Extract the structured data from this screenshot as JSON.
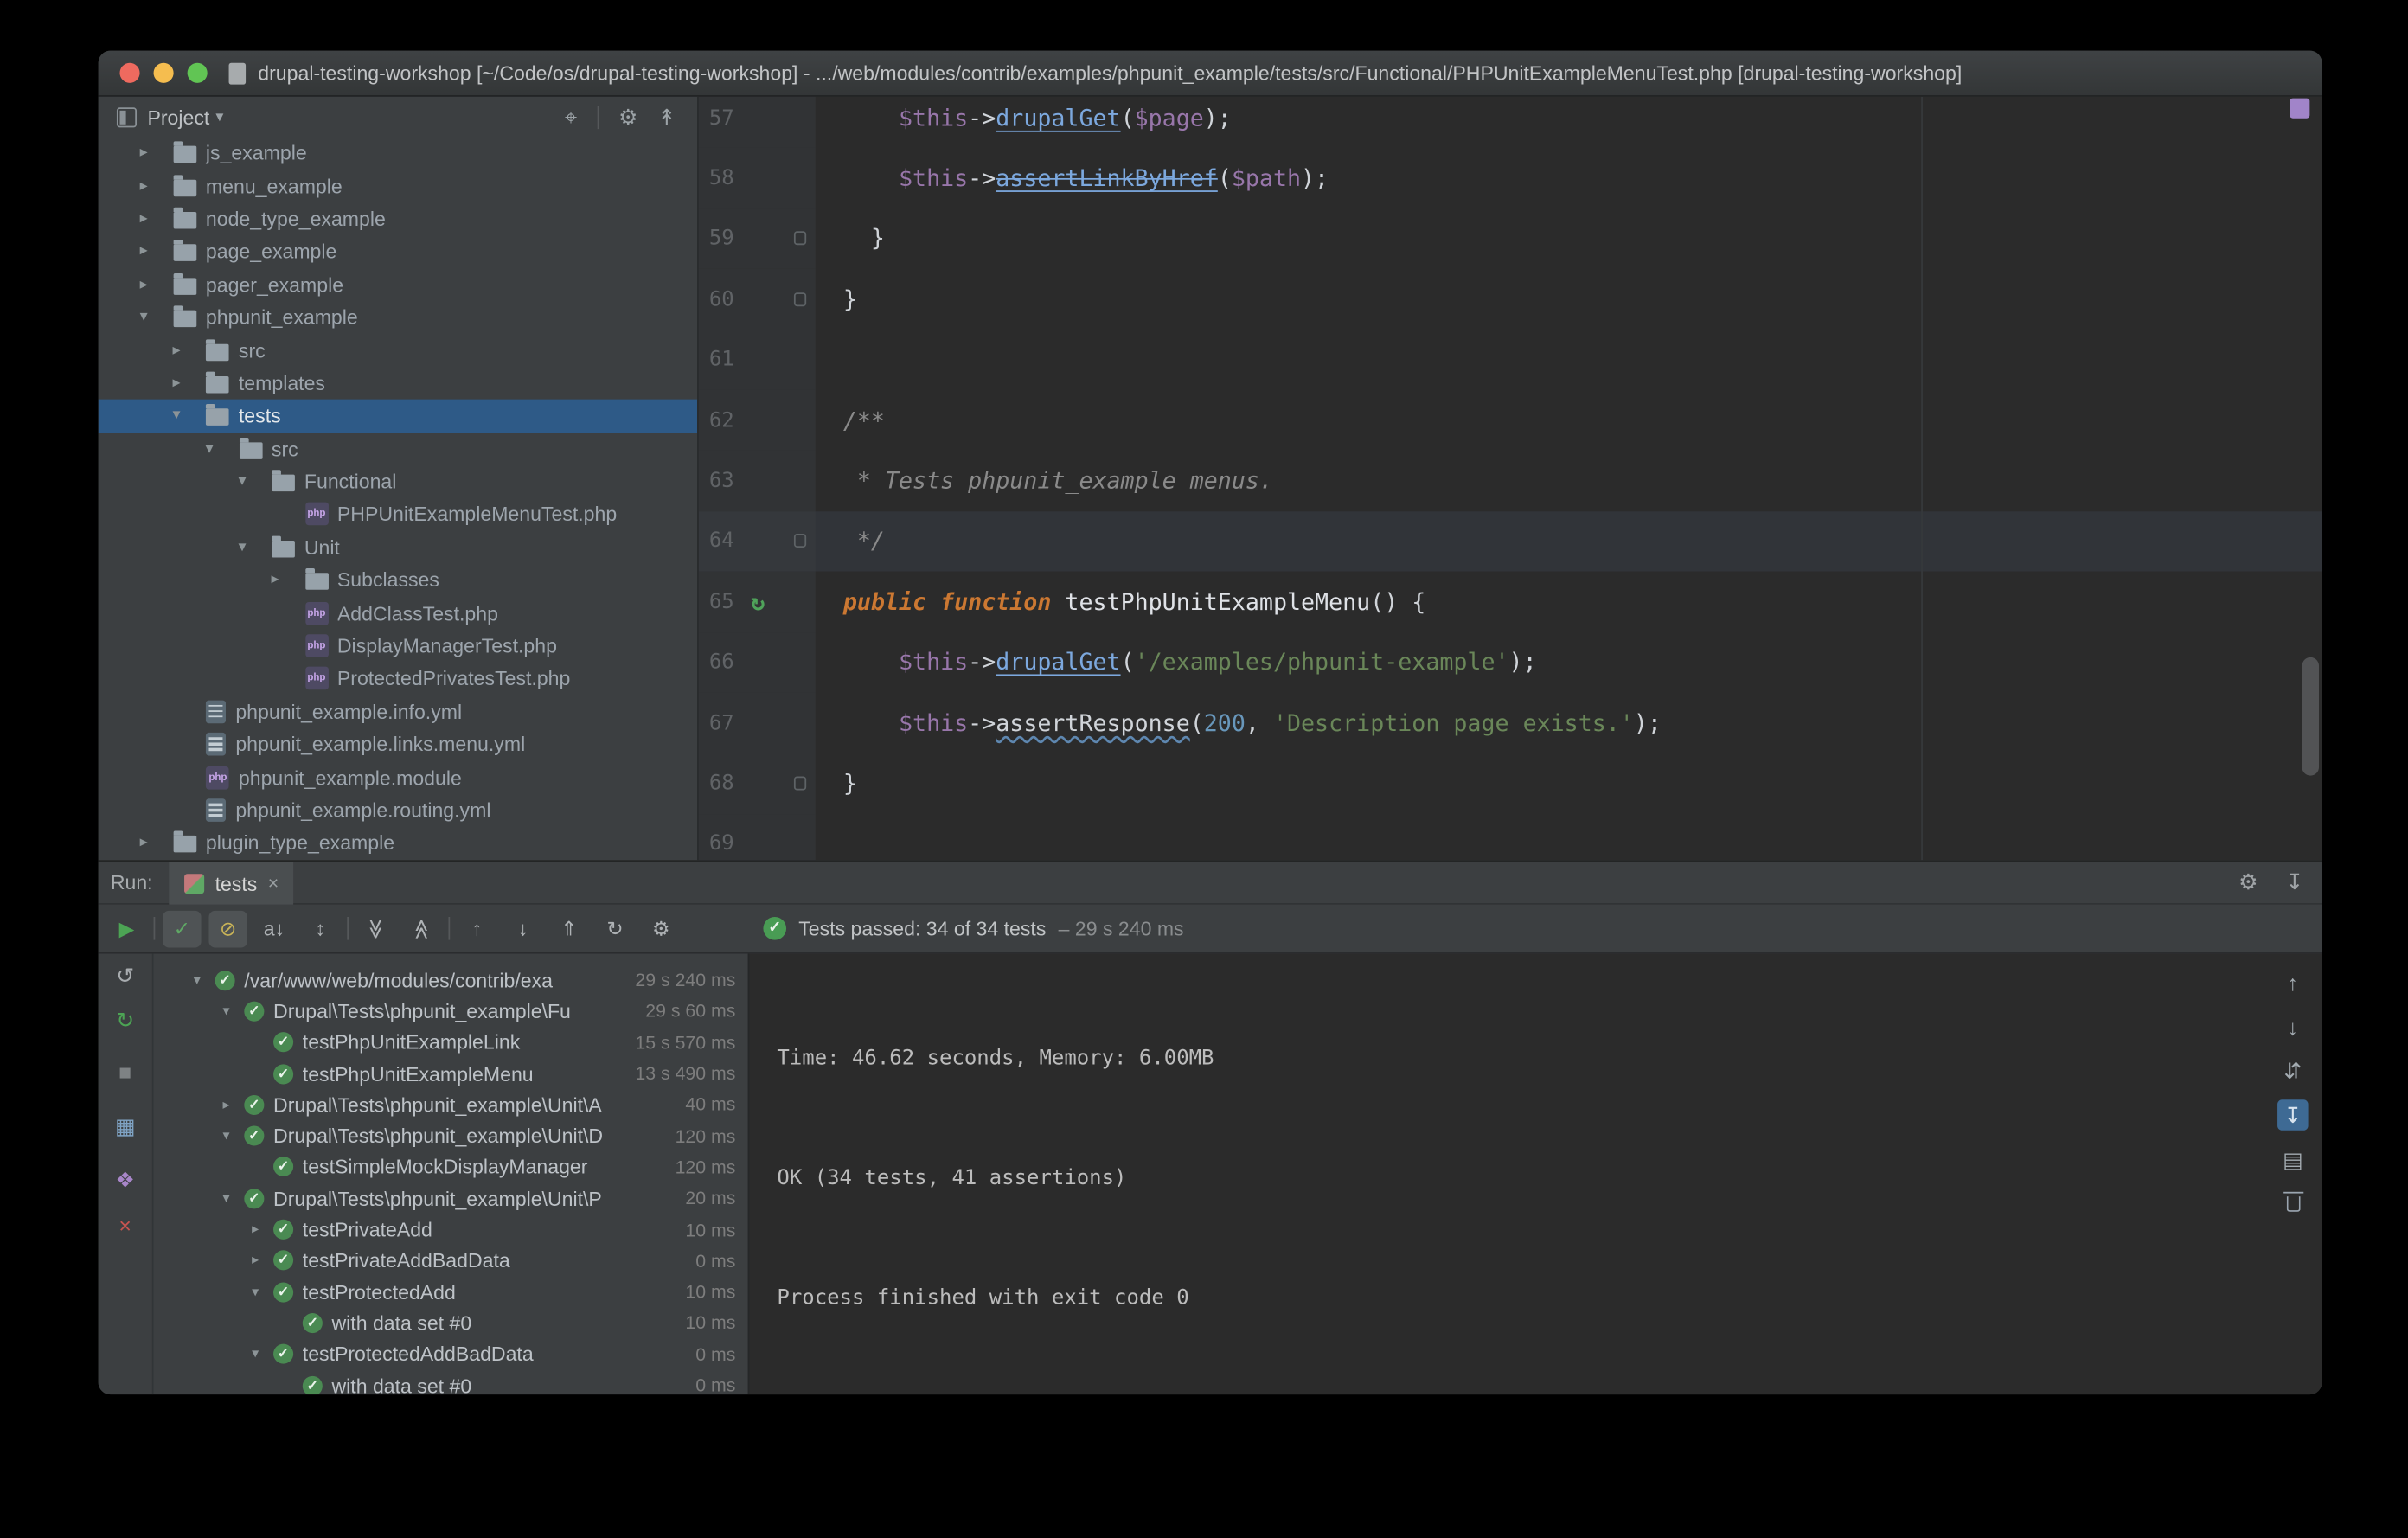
{
  "window": {
    "title": "drupal-testing-workshop [~/Code/os/drupal-testing-workshop] - .../web/modules/contrib/examples/phpunit_example/tests/src/Functional/PHPUnitExampleMenuTest.php [drupal-testing-workshop]"
  },
  "colors": {
    "accent_green": "#499C54",
    "selection_blue": "#2E5A87",
    "error_red": "#C75450",
    "editor_bg": "#2B2B2B",
    "panel_bg": "#3C3F41"
  },
  "project_panel": {
    "title": "Project",
    "actions": [
      {
        "name": "select-opened-file-button",
        "glyph": "⌖"
      },
      {
        "name": "divider"
      },
      {
        "name": "project-settings-button",
        "glyph": "⚙"
      },
      {
        "name": "collapse-all-button",
        "glyph": "↟"
      }
    ],
    "tree": [
      {
        "label": "js_example",
        "depth": 0,
        "arrow": "right",
        "icon": "folder"
      },
      {
        "label": "menu_example",
        "depth": 0,
        "arrow": "right",
        "icon": "folder"
      },
      {
        "label": "node_type_example",
        "depth": 0,
        "arrow": "right",
        "icon": "folder"
      },
      {
        "label": "page_example",
        "depth": 0,
        "arrow": "right",
        "icon": "folder"
      },
      {
        "label": "pager_example",
        "depth": 0,
        "arrow": "right",
        "icon": "folder"
      },
      {
        "label": "phpunit_example",
        "depth": 0,
        "arrow": "down",
        "icon": "folder"
      },
      {
        "label": "src",
        "depth": 1,
        "arrow": "right",
        "icon": "folder"
      },
      {
        "label": "templates",
        "depth": 1,
        "arrow": "right",
        "icon": "folder"
      },
      {
        "label": "tests",
        "depth": 1,
        "arrow": "down",
        "icon": "folder",
        "selected": true
      },
      {
        "label": "src",
        "depth": 2,
        "arrow": "down",
        "icon": "folder"
      },
      {
        "label": "Functional",
        "depth": 3,
        "arrow": "down",
        "icon": "folder"
      },
      {
        "label": "PHPUnitExampleMenuTest.php",
        "depth": 4,
        "icon": "php"
      },
      {
        "label": "Unit",
        "depth": 3,
        "arrow": "down",
        "icon": "folder"
      },
      {
        "label": "Subclasses",
        "depth": 4,
        "arrow": "right",
        "icon": "folder"
      },
      {
        "label": "AddClassTest.php",
        "depth": 4,
        "icon": "php"
      },
      {
        "label": "DisplayManagerTest.php",
        "depth": 4,
        "icon": "php"
      },
      {
        "label": "ProtectedPrivatesTest.php",
        "depth": 4,
        "icon": "php"
      },
      {
        "label": "phpunit_example.info.yml",
        "depth": 1,
        "icon": "yml"
      },
      {
        "label": "phpunit_example.links.menu.yml",
        "depth": 1,
        "icon": "yml"
      },
      {
        "label": "phpunit_example.module",
        "depth": 1,
        "icon": "module"
      },
      {
        "label": "phpunit_example.routing.yml",
        "depth": 1,
        "icon": "yml"
      },
      {
        "label": "plugin_type_example",
        "depth": 0,
        "arrow": "right",
        "icon": "folder"
      }
    ]
  },
  "editor": {
    "lines": [
      {
        "num": 57,
        "seg": [
          [
            "      ",
            "p"
          ],
          [
            "$this",
            "v"
          ],
          [
            "->",
            "p"
          ],
          [
            "drupalGet",
            "lk"
          ],
          [
            "(",
            "p"
          ],
          [
            "$page",
            "v"
          ],
          [
            ");",
            "p"
          ]
        ]
      },
      {
        "num": 58,
        "seg": [
          [
            "      ",
            "p"
          ],
          [
            "$this",
            "v"
          ],
          [
            "->",
            "p"
          ],
          [
            "assertLinkByHref",
            "dep"
          ],
          [
            "(",
            "p"
          ],
          [
            "$path",
            "v"
          ],
          [
            ");",
            "p"
          ]
        ]
      },
      {
        "num": 59,
        "seg": [
          [
            "    }",
            "p"
          ]
        ],
        "mark": "fold"
      },
      {
        "num": 60,
        "seg": [
          [
            "  }",
            "p"
          ]
        ],
        "mark": "fold"
      },
      {
        "num": 61,
        "seg": []
      },
      {
        "num": 62,
        "seg": [
          [
            "  /**",
            "cm"
          ]
        ]
      },
      {
        "num": 63,
        "seg": [
          [
            "   * Tests phpunit_example menus.",
            "cm"
          ]
        ]
      },
      {
        "num": 64,
        "seg": [
          [
            "   */",
            "cm"
          ]
        ],
        "mark": "fold",
        "hl": true
      },
      {
        "num": 65,
        "seg": [
          [
            "  ",
            "p"
          ],
          [
            "public function ",
            "kw"
          ],
          [
            "testPhpUnitExampleMenu",
            "fn"
          ],
          [
            "() {",
            "p"
          ]
        ],
        "mark": "run"
      },
      {
        "num": 66,
        "seg": [
          [
            "      ",
            "p"
          ],
          [
            "$this",
            "v"
          ],
          [
            "->",
            "p"
          ],
          [
            "drupalGet",
            "lk"
          ],
          [
            "(",
            "p"
          ],
          [
            "'/examples/phpunit-example'",
            "st"
          ],
          [
            ");",
            "p"
          ]
        ]
      },
      {
        "num": 67,
        "seg": [
          [
            "      ",
            "p"
          ],
          [
            "$this",
            "v"
          ],
          [
            "->",
            "p"
          ],
          [
            "assertResponse",
            "warn"
          ],
          [
            "(",
            "p"
          ],
          [
            "200",
            "num"
          ],
          [
            ", ",
            "p"
          ],
          [
            "'Description page exists.'",
            "st"
          ],
          [
            ");",
            "p"
          ]
        ]
      },
      {
        "num": 68,
        "seg": [
          [
            "  }",
            "p"
          ]
        ],
        "mark": "fold"
      },
      {
        "num": 69,
        "seg": []
      }
    ]
  },
  "run_panel": {
    "label": "Run:",
    "tab_label": "tests",
    "status": {
      "message": "Tests passed: 34 of 34 tests",
      "time": "– 29 s 240 ms"
    },
    "strip_actions": [
      {
        "name": "run-panel-settings-button",
        "glyph": "⚙"
      },
      {
        "name": "hide-panel-button",
        "glyph": "↧"
      }
    ],
    "toolbar_icons": [
      {
        "name": "rerun-tests-button",
        "glyph": "▶",
        "color": "#4CA454"
      },
      {
        "name": "divider"
      },
      {
        "name": "show-passed-toggle",
        "glyph": "✓",
        "color": "#5FA865",
        "pressed": true
      },
      {
        "name": "show-ignored-toggle",
        "glyph": "⊘",
        "color": "#C9B458",
        "pressed": true
      },
      {
        "name": "sort-alphabetically-toggle",
        "glyph": "a↓"
      },
      {
        "name": "sort-by-duration-toggle",
        "glyph": "↕"
      },
      {
        "name": "divider"
      },
      {
        "name": "expand-all-button",
        "glyph": "≫",
        "rot": 90
      },
      {
        "name": "collapse-all-button",
        "glyph": "≫",
        "rot": -90
      },
      {
        "name": "divider"
      },
      {
        "name": "previous-failed-test-button",
        "glyph": "↑"
      },
      {
        "name": "next-failed-test-button",
        "glyph": "↓"
      },
      {
        "name": "import-test-results-button",
        "glyph": "⇑"
      },
      {
        "name": "test-history-button",
        "glyph": "↻"
      },
      {
        "name": "run-configuration-settings-button",
        "glyph": "⚙"
      }
    ],
    "left_rail_icons": [
      {
        "name": "rerun-icon",
        "glyph": "↺",
        "color": "#A8ACAF"
      },
      {
        "name": "rerun-failed-tests-icon",
        "glyph": "↻",
        "color": "#4CA454"
      },
      {
        "name": "stop-icon",
        "glyph": "■",
        "color": "#7E8284"
      },
      {
        "name": "dump-threads-icon",
        "glyph": "▦",
        "color": "#7FA3C4"
      },
      {
        "name": "pin-tab-icon",
        "glyph": "❖",
        "color": "#A886C9"
      },
      {
        "name": "close-panel-icon",
        "glyph": "×",
        "color": "#C75450"
      }
    ],
    "right_rail_icons": [
      {
        "name": "prev-occurrence-button",
        "glyph": "↑"
      },
      {
        "name": "next-occurrence-button",
        "glyph": "↓"
      },
      {
        "name": "soft-wrap-button",
        "glyph": "⇵"
      },
      {
        "name": "scroll-to-end-button",
        "glyph": "↧",
        "selected": true
      },
      {
        "name": "print-console-button",
        "glyph": "▤"
      },
      {
        "name": "clear-console-button",
        "glyph": "trash"
      }
    ],
    "tests": [
      {
        "label": "/var/www/web/modules/contrib/exa",
        "time": "29 s 240 ms",
        "depth": 0,
        "arrow": "down"
      },
      {
        "label": "Drupal\\Tests\\phpunit_example\\Fu",
        "time": "29 s 60 ms",
        "depth": 1,
        "arrow": "down"
      },
      {
        "label": "testPhpUnitExampleLink",
        "time": "15 s 570 ms",
        "depth": 2
      },
      {
        "label": "testPhpUnitExampleMenu",
        "time": "13 s 490 ms",
        "depth": 2
      },
      {
        "label": "Drupal\\Tests\\phpunit_example\\Unit\\A",
        "time": "40 ms",
        "depth": 1,
        "arrow": "right"
      },
      {
        "label": "Drupal\\Tests\\phpunit_example\\Unit\\D",
        "time": "120 ms",
        "depth": 1,
        "arrow": "down"
      },
      {
        "label": "testSimpleMockDisplayManager",
        "time": "120 ms",
        "depth": 2
      },
      {
        "label": "Drupal\\Tests\\phpunit_example\\Unit\\P",
        "time": "20 ms",
        "depth": 1,
        "arrow": "down"
      },
      {
        "label": "testPrivateAdd",
        "time": "10 ms",
        "depth": 2,
        "arrow": "right"
      },
      {
        "label": "testPrivateAddBadData",
        "time": "0 ms",
        "depth": 2,
        "arrow": "right"
      },
      {
        "label": "testProtectedAdd",
        "time": "10 ms",
        "depth": 2,
        "arrow": "down"
      },
      {
        "label": "with data set #0",
        "time": "10 ms",
        "depth": 3
      },
      {
        "label": "testProtectedAddBadData",
        "time": "0 ms",
        "depth": 2,
        "arrow": "down"
      },
      {
        "label": "with data set #0",
        "time": "0 ms",
        "depth": 3
      }
    ],
    "console_lines": [
      "",
      "",
      "Time: 46.62 seconds, Memory: 6.00MB",
      "",
      "",
      "OK (34 tests, 41 assertions)",
      "",
      "",
      "Process finished with exit code 0"
    ]
  }
}
